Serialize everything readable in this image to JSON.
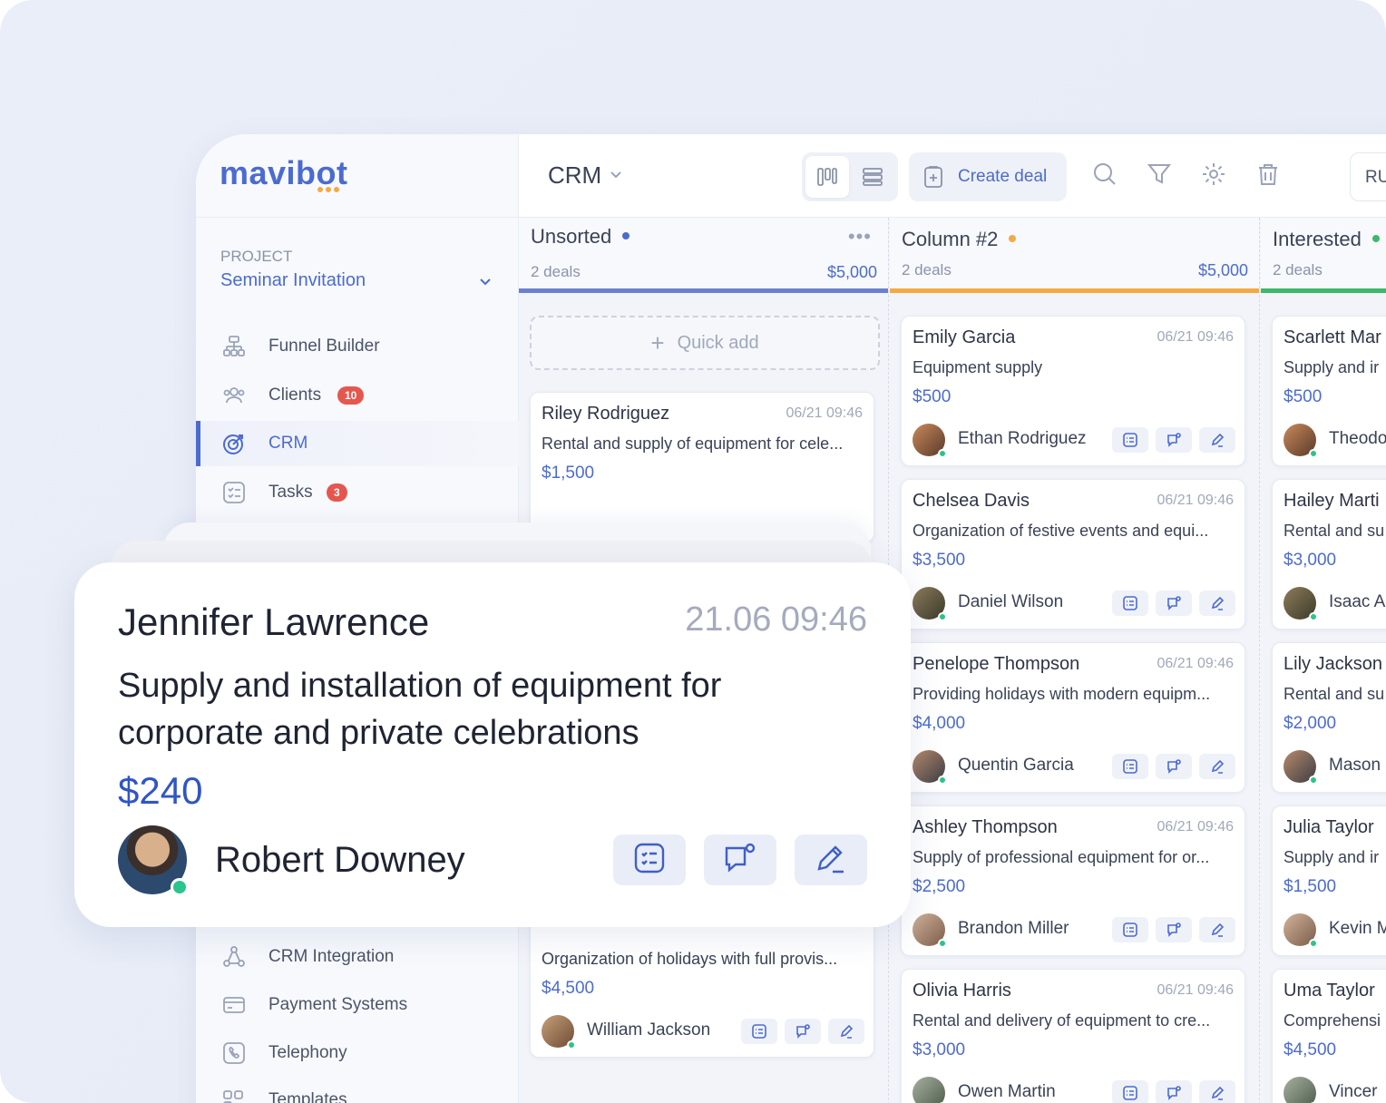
{
  "brand": {
    "logo": "mavibot",
    "accent": "#4c6bd1"
  },
  "sidebar": {
    "project_label": "PROJECT",
    "project_name": "Seminar Invitation",
    "items": [
      {
        "label": "Funnel Builder",
        "icon": "funnel-builder-icon"
      },
      {
        "label": "Clients",
        "icon": "users-icon",
        "badge": "10"
      },
      {
        "label": "CRM",
        "icon": "target-icon",
        "active": true
      },
      {
        "label": "Tasks",
        "icon": "tasks-icon",
        "badge": "3"
      },
      {
        "label": "CRM Integration",
        "icon": "integration-icon"
      },
      {
        "label": "Payment Systems",
        "icon": "card-icon"
      },
      {
        "label": "Telephony",
        "icon": "phone-icon"
      },
      {
        "label": "Templates",
        "icon": "templates-icon"
      }
    ]
  },
  "topbar": {
    "title": "CRM",
    "create_deal": "Create deal",
    "lang": "RU"
  },
  "columns": [
    {
      "title": "Unsorted",
      "dot": "#4c6bd1",
      "bar": "#6b80cf",
      "count": "2 deals",
      "sum": "$5,000",
      "quick_add": "Quick add",
      "cards": [
        {
          "name": "Riley Rodriguez",
          "time": "06/21 09:46",
          "desc": "Rental and supply of equipment for cele...",
          "price": "$1,500",
          "owner": ""
        },
        {
          "name": "",
          "time": "",
          "desc": "Organization of holidays with full provis...",
          "price": "$4,500",
          "owner": "William Jackson"
        }
      ]
    },
    {
      "title": "Column #2",
      "dot": "#f5a942",
      "bar": "#f5a942",
      "count": "2 deals",
      "sum": "$5,000",
      "cards": [
        {
          "name": "Emily Garcia",
          "time": "06/21 09:46",
          "desc": "Equipment supply",
          "price": "$500",
          "owner": "Ethan Rodriguez"
        },
        {
          "name": "Chelsea Davis",
          "time": "06/21 09:46",
          "desc": "Organization of festive events and equi...",
          "price": "$3,500",
          "owner": "Daniel Wilson"
        },
        {
          "name": "Penelope Thompson",
          "time": "06/21 09:46",
          "desc": "Providing holidays with modern equipm...",
          "price": "$4,000",
          "owner": "Quentin Garcia"
        },
        {
          "name": "Ashley Thompson",
          "time": "06/21 09:46",
          "desc": "Supply of professional equipment for or...",
          "price": "$2,500",
          "owner": "Brandon Miller"
        },
        {
          "name": "Olivia Harris",
          "time": "06/21 09:46",
          "desc": "Rental and delivery of equipment to cre...",
          "price": "$3,000",
          "owner": "Owen Martin"
        }
      ]
    },
    {
      "title": "Interested",
      "dot": "#3cb96b",
      "bar": "#3cb96b",
      "count": "2 deals",
      "sum": "",
      "cards": [
        {
          "name": "Scarlett Mar",
          "time": "",
          "desc": "Supply and ir",
          "price": "$500",
          "owner": "Theodo"
        },
        {
          "name": "Hailey Marti",
          "time": "",
          "desc": "Rental and su",
          "price": "$3,000",
          "owner": "Isaac A"
        },
        {
          "name": "Lily Jackson",
          "time": "",
          "desc": "Rental and su",
          "price": "$2,000",
          "owner": "Mason"
        },
        {
          "name": "Julia Taylor",
          "time": "",
          "desc": "Supply and ir",
          "price": "$1,500",
          "owner": "Kevin M"
        },
        {
          "name": "Uma Taylor",
          "time": "",
          "desc": "Comprehensi",
          "price": "$4,500",
          "owner": "Vincer"
        }
      ]
    }
  ],
  "focus_card": {
    "name": "Jennifer Lawrence",
    "time": "21.06 09:46",
    "desc": "Supply and installation of equipment for corporate and private celebrations",
    "price": "$240",
    "owner": "Robert Downey"
  }
}
